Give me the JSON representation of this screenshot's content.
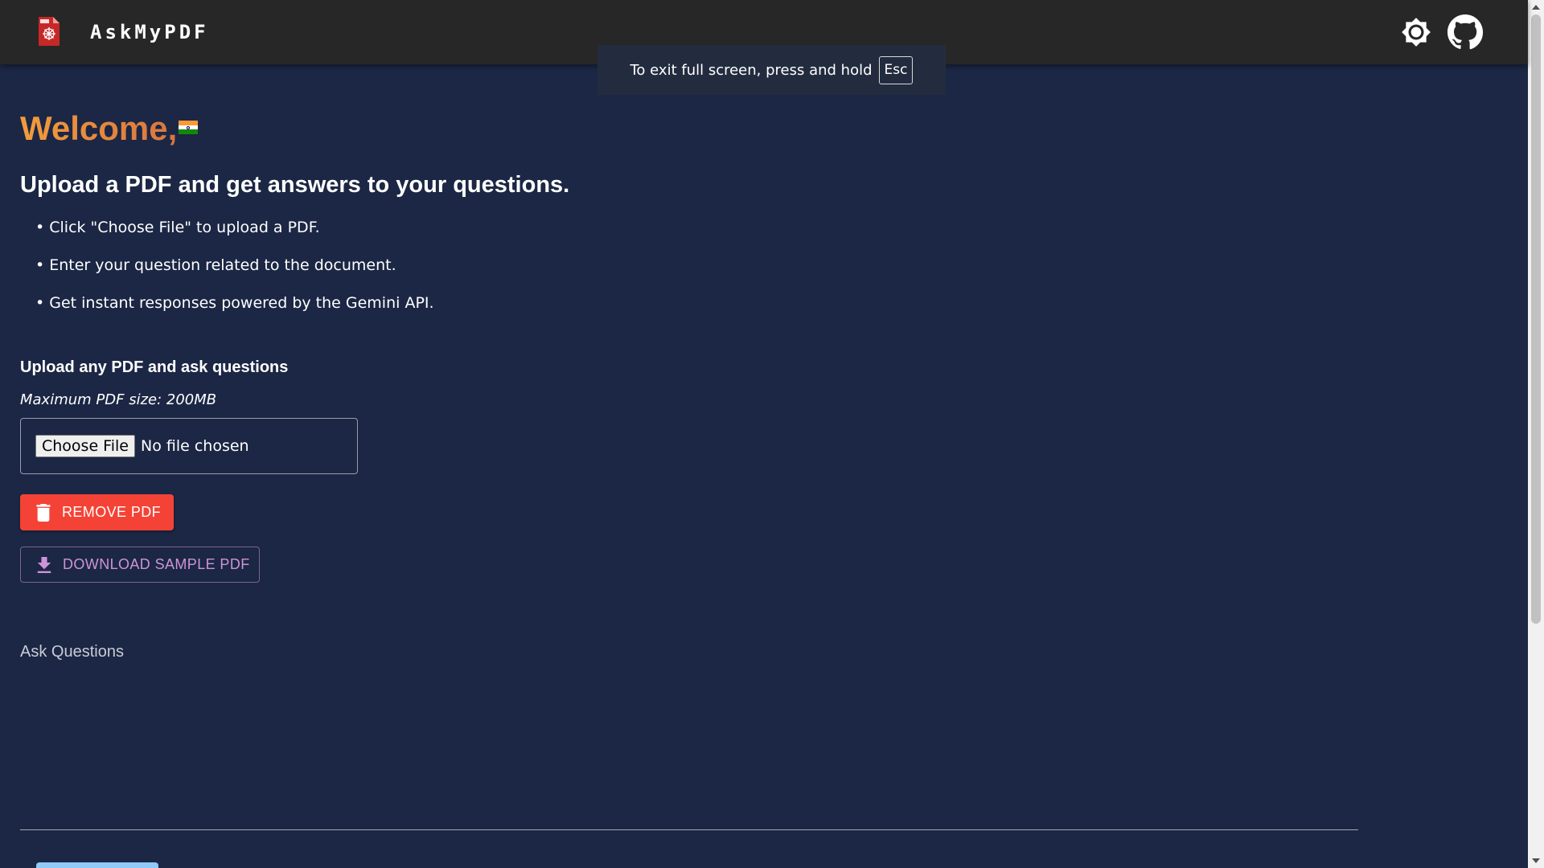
{
  "header": {
    "brand": "AskMyPDF",
    "logo_icon": "pdf-file-icon",
    "theme_icon": "brightness-icon",
    "github_icon": "github-icon"
  },
  "fullscreen_notice": {
    "text": "To exit full screen, press and hold",
    "key": "Esc"
  },
  "main": {
    "welcome": "Welcome,",
    "flag_icon": "india-flag-icon",
    "heading": "Upload a PDF and get answers to your questions.",
    "bullets": [
      "• Click \"Choose File\" to upload a PDF.",
      "• Enter your question related to the document.",
      "• Get instant responses powered by the Gemini API."
    ],
    "upload_title": "Upload any PDF and ask questions",
    "upload_limit": "Maximum PDF size: 200MB",
    "file_input": {
      "button_label": "Choose File",
      "status": "No file chosen"
    },
    "remove_button": "REMOVE PDF",
    "download_button": "DOWNLOAD SAMPLE PDF",
    "ask_title": "Ask Questions"
  },
  "colors": {
    "background": "#1b2744",
    "appbar": "#272727",
    "welcome_gradient_start": "#f39c3d",
    "welcome_gradient_end": "#d8753f",
    "remove_button": "#f44336",
    "download_text": "#ce93d8",
    "bottom_button": "#90caf9"
  }
}
